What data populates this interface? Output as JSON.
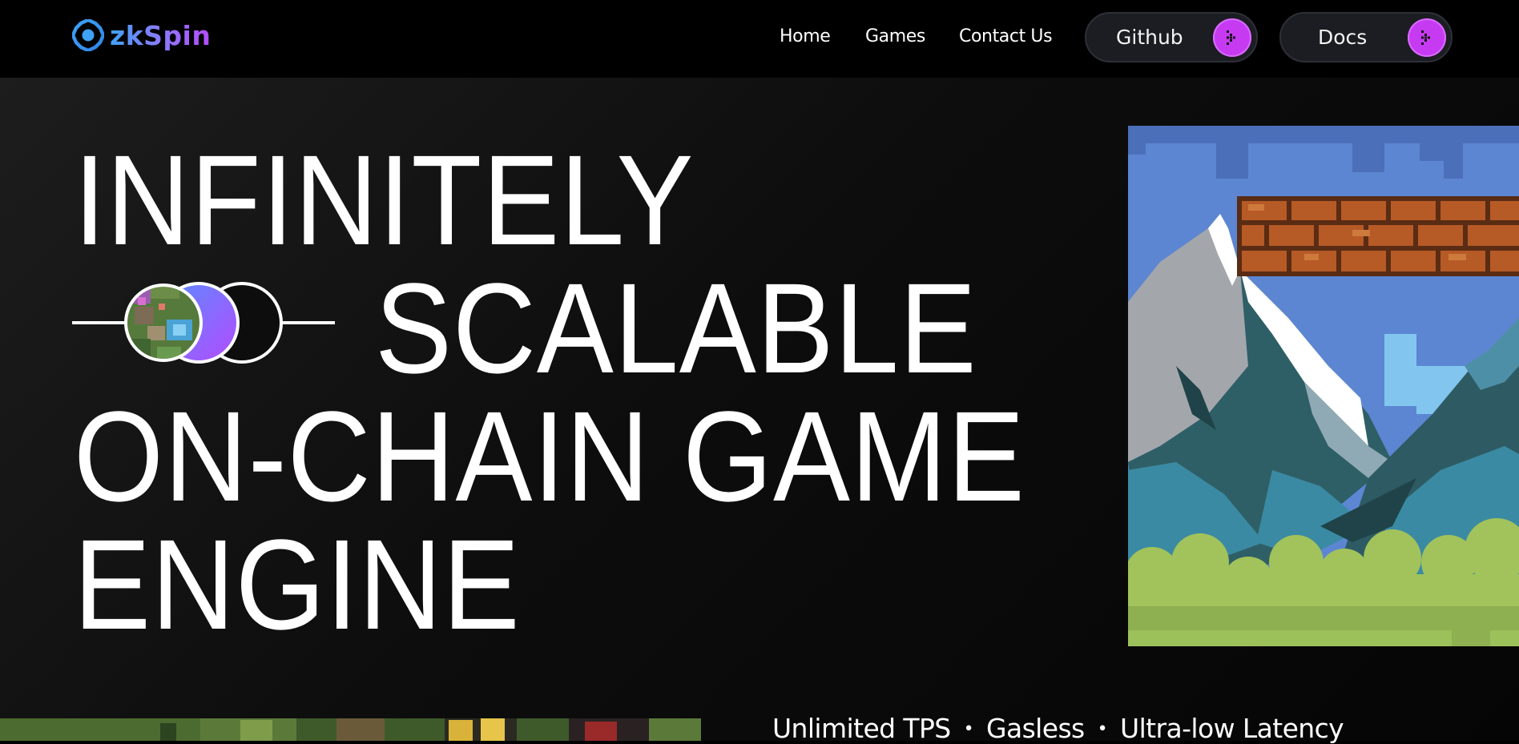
{
  "brand": {
    "name": "zkSpin",
    "icon": "gear-ring-icon",
    "gradient": [
      "#3fa1f5",
      "#b44bff"
    ]
  },
  "nav": {
    "links": [
      {
        "label": "Home"
      },
      {
        "label": "Games"
      },
      {
        "label": "Contact Us"
      }
    ],
    "buttons": [
      {
        "label": "Github",
        "icon": "arrow-right-icon"
      },
      {
        "label": "Docs",
        "icon": "arrow-right-icon"
      }
    ]
  },
  "hero": {
    "lines": [
      "INFINITELY",
      "SCALABLE",
      "ON-CHAIN GAME",
      "ENGINE"
    ]
  },
  "features": {
    "items": [
      "Unlimited TPS",
      "Gasless",
      "Ultra-low Latency"
    ],
    "separator": "•"
  },
  "colors": {
    "accent": "#c63bf2",
    "background": "#000000",
    "text": "#ffffff"
  }
}
